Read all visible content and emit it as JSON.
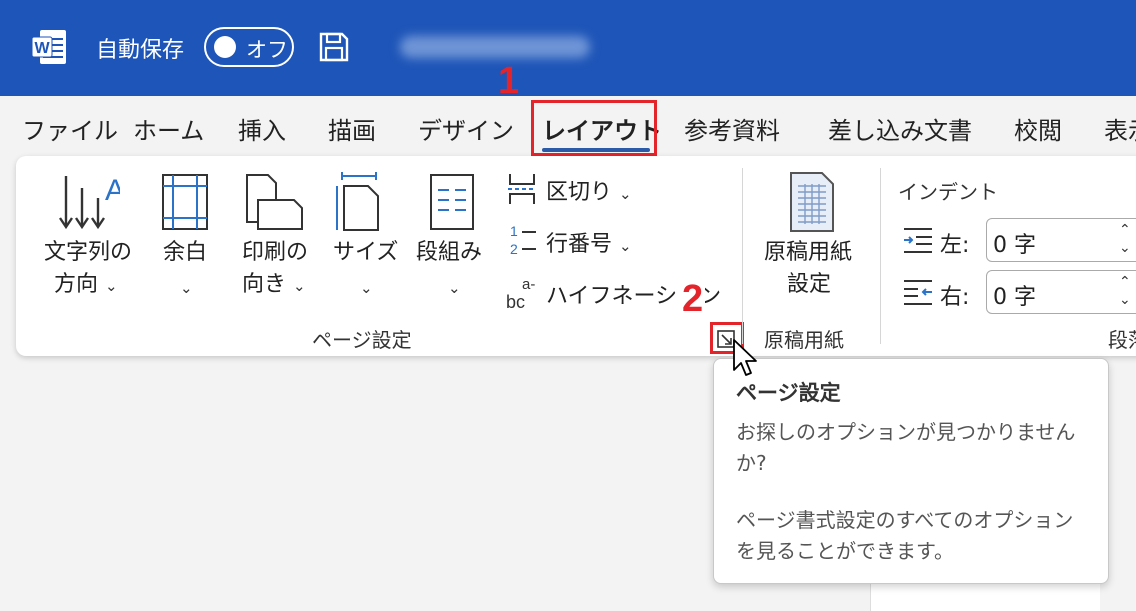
{
  "titlebar": {
    "app_icon": "word-icon",
    "autosave_label": "自動保存",
    "autosave_state": "オフ",
    "save_icon": "save-icon",
    "bg_color": "#1e55b8"
  },
  "tabs": [
    {
      "label": "ファイル"
    },
    {
      "label": "ホーム"
    },
    {
      "label": "挿入"
    },
    {
      "label": "描画"
    },
    {
      "label": "デザイン"
    },
    {
      "label": "レイアウト",
      "active": true
    },
    {
      "label": "参考資料"
    },
    {
      "label": "差し込み文書"
    },
    {
      "label": "校閲"
    },
    {
      "label": "表示"
    }
  ],
  "annotations": {
    "step1": "1",
    "step2": "2",
    "highlight_color": "#e4242b"
  },
  "ribbon": {
    "page_setup": {
      "text_direction": {
        "line1": "文字列の",
        "line2": "方向"
      },
      "margins": {
        "label": "余白"
      },
      "orientation": {
        "line1": "印刷の",
        "line2": "向き"
      },
      "size": {
        "label": "サイズ"
      },
      "columns": {
        "label": "段組み"
      },
      "breaks": {
        "label": "区切り"
      },
      "line_numbers": {
        "label": "行番号"
      },
      "hyphenation": {
        "label": "ハイフネーション"
      },
      "group_label": "ページ設定"
    },
    "genkou": {
      "button": {
        "line1": "原稿用紙",
        "line2": "設定"
      },
      "group_label": "原稿用紙"
    },
    "paragraph": {
      "indent_header": "インデント",
      "left": {
        "label": "左:",
        "value": "0 字"
      },
      "right": {
        "label": "右:",
        "value": "0 字"
      },
      "group_label_partial": "段落"
    }
  },
  "tooltip": {
    "title": "ページ設定",
    "question": "お探しのオプションが見つかりませんか?",
    "description": "ページ書式設定のすべてのオプションを見ることができます。"
  }
}
